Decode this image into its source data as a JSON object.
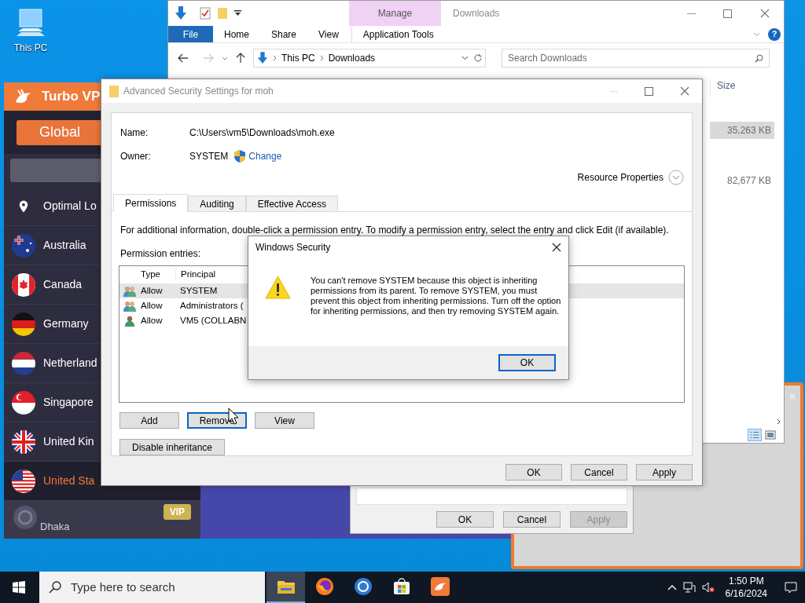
{
  "desktop_icons": [
    {
      "label": "This PC"
    }
  ],
  "explorer": {
    "title": "Downloads",
    "context_tab": "Manage",
    "ribbon_tabs": [
      {
        "label": "File",
        "selected": true
      },
      {
        "label": "Home",
        "selected": false
      },
      {
        "label": "Share",
        "selected": false
      },
      {
        "label": "View",
        "selected": false
      },
      {
        "label": "Application Tools",
        "selected": false
      }
    ],
    "help_button": "?",
    "breadcrumb": [
      "This PC",
      "Downloads"
    ],
    "search": {
      "placeholder": "Search Downloads"
    },
    "size_header": "Size",
    "sizes": [
      {
        "text": "35,263 KB",
        "selected": true
      },
      {
        "text": "82,677 KB",
        "selected": false
      }
    ]
  },
  "vpn": {
    "title": "Turbo VP",
    "mode_button": "Global",
    "locations": [
      {
        "label": "Optimal Lo",
        "kind": "pin",
        "selected": false
      },
      {
        "label": "Australia",
        "kind": "au",
        "selected": false
      },
      {
        "label": "Canada",
        "kind": "ca",
        "selected": false
      },
      {
        "label": "Germany",
        "kind": "de",
        "selected": false
      },
      {
        "label": "Netherland",
        "kind": "nl",
        "selected": false
      },
      {
        "label": "Singapore",
        "kind": "sg",
        "selected": false
      },
      {
        "label": "United Kin",
        "kind": "uk",
        "selected": false
      },
      {
        "label": "United Sta",
        "kind": "us",
        "selected": true
      }
    ],
    "footer": {
      "label": "Dhaka",
      "badge": "VIP"
    }
  },
  "back_dialog": {
    "buttons": [
      {
        "label": "OK",
        "disabled": false
      },
      {
        "label": "Cancel",
        "disabled": false
      },
      {
        "label": "Apply",
        "disabled": true
      }
    ]
  },
  "security_window": {
    "title": "Advanced Security Settings for moh",
    "name_label": "Name:",
    "name_value": "C:\\Users\\vm5\\Downloads\\moh.exe",
    "owner_label": "Owner:",
    "owner_value": "SYSTEM",
    "change_link": "Change",
    "resource_properties": "Resource Properties",
    "tabs": [
      {
        "label": "Permissions",
        "selected": true
      },
      {
        "label": "Auditing",
        "selected": false
      },
      {
        "label": "Effective Access",
        "selected": false
      }
    ],
    "info": "For additional information, double-click a permission entry. To modify a permission entry, select the entry and click Edit (if available).",
    "entries_label": "Permission entries:",
    "columns": [
      "Type",
      "Principal"
    ],
    "rows": [
      {
        "kind": "group",
        "type": "Allow",
        "principal": "SYSTEM",
        "selected": true
      },
      {
        "kind": "group",
        "type": "Allow",
        "principal": "Administrators (",
        "selected": false
      },
      {
        "kind": "user",
        "type": "Allow",
        "principal": "VM5 (COLLABN",
        "selected": false
      }
    ],
    "entry_buttons": [
      {
        "label": "Add",
        "focused": false
      },
      {
        "label": "Remove",
        "focused": true
      },
      {
        "label": "View",
        "focused": false
      }
    ],
    "inheritance_button": "Disable inheritance",
    "buttons": [
      "OK",
      "Cancel",
      "Apply"
    ]
  },
  "message_box": {
    "title": "Windows Security",
    "message": "You can't remove SYSTEM because this object is inheriting permissions from its parent. To remove SYSTEM, you must prevent this object from inheriting permissions.  Turn off the option for inheriting permissions, and then try removing SYSTEM again.",
    "button": "OK"
  },
  "taskbar": {
    "search_placeholder": "Type here to search",
    "apps": [
      {
        "kind": "folder",
        "active": true
      },
      {
        "kind": "firefox",
        "active": false
      },
      {
        "kind": "browser",
        "active": false
      },
      {
        "kind": "store",
        "active": false
      },
      {
        "kind": "vpn",
        "active": false
      }
    ],
    "time": "1:50 PM",
    "date": "6/16/2024"
  }
}
